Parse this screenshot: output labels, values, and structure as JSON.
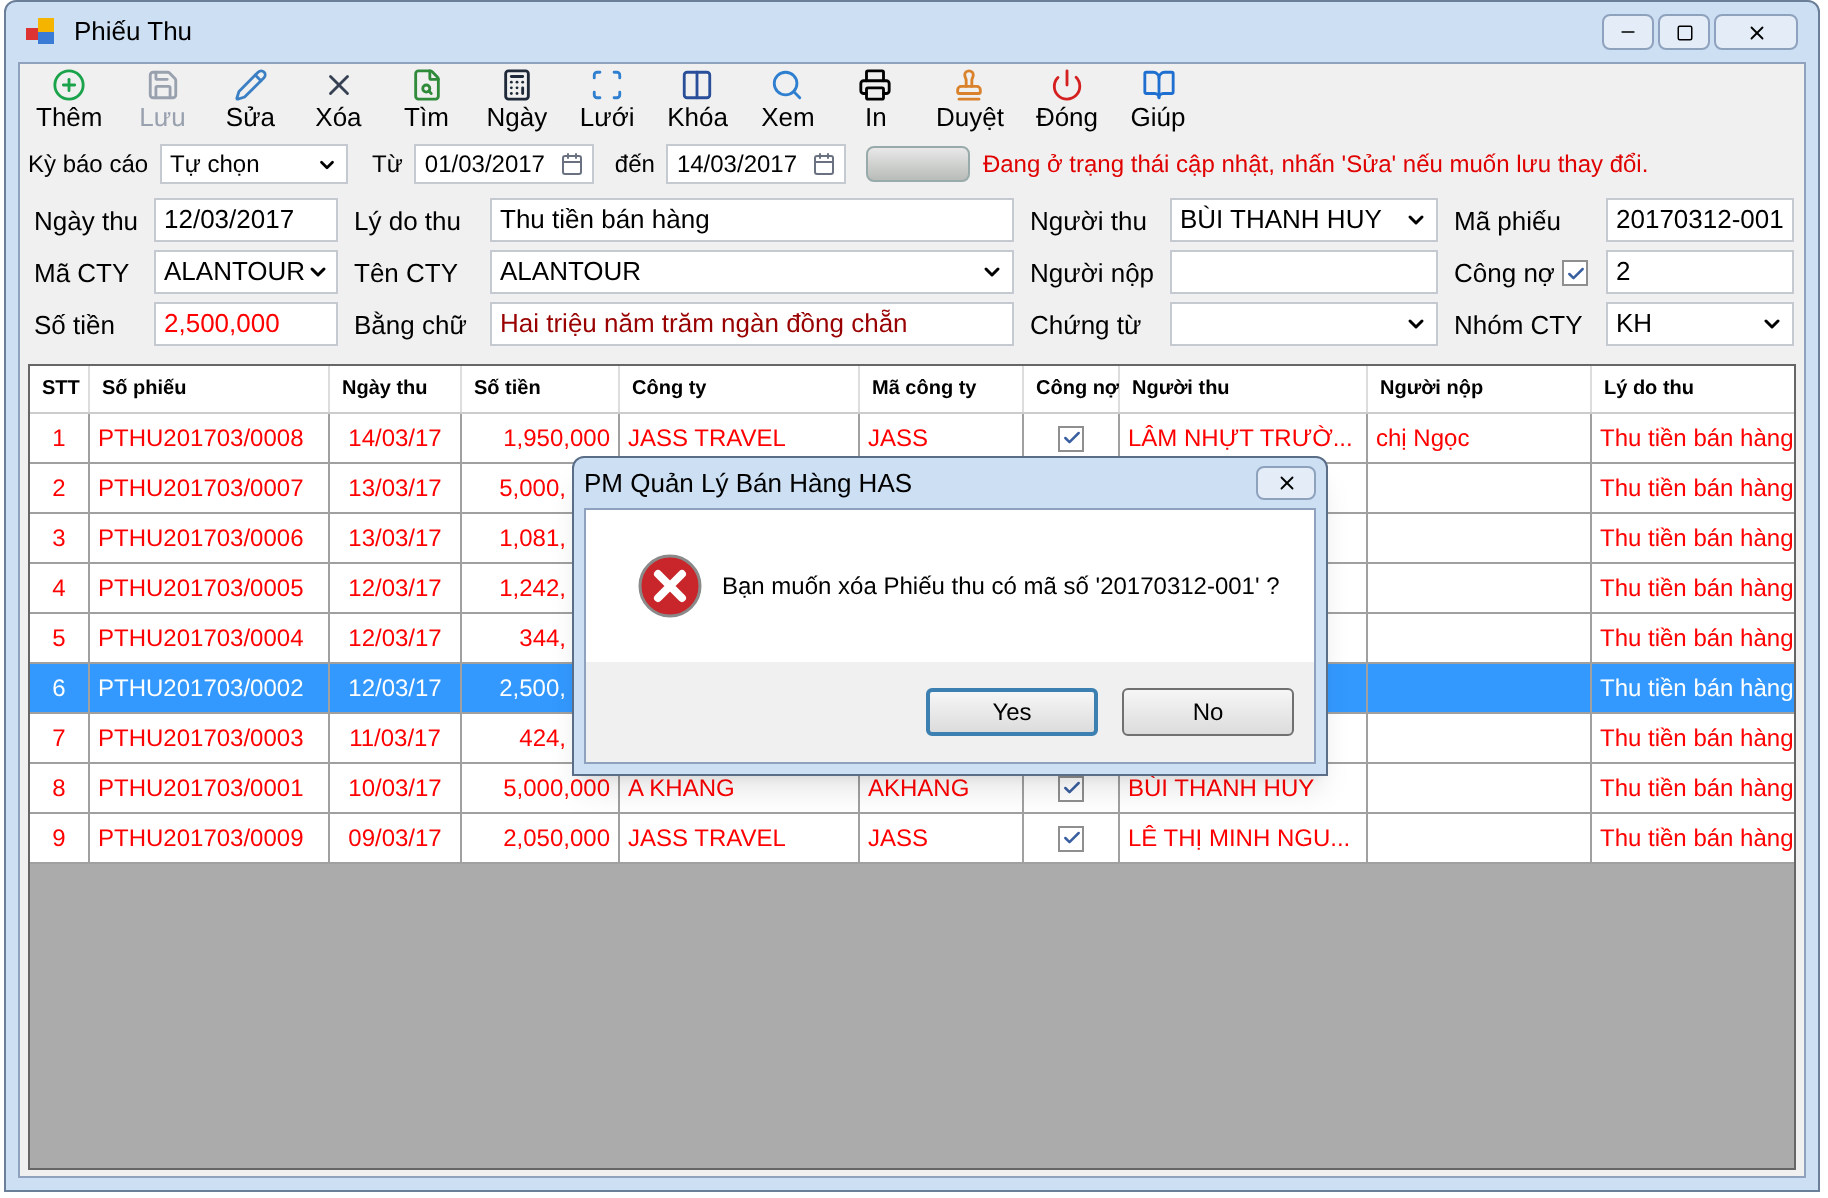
{
  "window": {
    "title": "Phiếu Thu"
  },
  "toolbar": [
    {
      "label": "Thêm",
      "kind": "add",
      "disabled": false
    },
    {
      "label": "Lưu",
      "kind": "save",
      "disabled": true
    },
    {
      "label": "Sửa",
      "kind": "edit",
      "disabled": false
    },
    {
      "label": "Xóa",
      "kind": "delete",
      "disabled": false
    },
    {
      "label": "Tìm",
      "kind": "find",
      "disabled": false
    },
    {
      "label": "Ngày",
      "kind": "date",
      "disabled": false
    },
    {
      "label": "Lưới",
      "kind": "grid",
      "disabled": false
    },
    {
      "label": "Khóa",
      "kind": "lock",
      "disabled": false
    },
    {
      "label": "Xem",
      "kind": "view",
      "disabled": false
    },
    {
      "label": "In",
      "kind": "print",
      "disabled": false
    },
    {
      "label": "Duyệt",
      "kind": "approve",
      "disabled": false
    },
    {
      "label": "Đóng",
      "kind": "close",
      "disabled": false
    },
    {
      "label": "Giúp",
      "kind": "help",
      "disabled": false
    }
  ],
  "filter": {
    "period_label": "Kỳ báo cáo",
    "period": "Tự chọn",
    "from_label": "Từ",
    "from": "01/03/2017",
    "to_label": "đến",
    "to": "14/03/2017",
    "status": "Đang ở trạng thái cập nhật, nhấn 'Sửa' nếu muốn lưu thay đổi."
  },
  "form": [
    [
      {
        "label": "Ngày thu",
        "value": "12/03/2017",
        "kind": "text"
      },
      {
        "label": "Lý do thu",
        "value": "Thu tiền bán hàng",
        "kind": "text"
      },
      {
        "label": "Người thu",
        "value": "BÙI THANH HUY",
        "kind": "combo"
      },
      {
        "label": "Mã phiếu",
        "value": "20170312-001",
        "kind": "text"
      }
    ],
    [
      {
        "label": "Mã CTY",
        "value": "ALANTOUR",
        "kind": "combo"
      },
      {
        "label": "Tên CTY",
        "value": "ALANTOUR",
        "kind": "combo"
      },
      {
        "label": "Người nộp",
        "kind": "text"
      },
      {
        "label": "Công nợ",
        "value": "2",
        "kind": "check",
        "checked": true
      }
    ],
    [
      {
        "label": "Số tiền",
        "value": "2,500,000",
        "kind": "text",
        "color": "#ff0000"
      },
      {
        "label": "Bằng chữ",
        "value": "Hai triệu năm trăm ngàn đồng chẵn",
        "kind": "text",
        "color": "#990000"
      },
      {
        "label": "Chứng từ",
        "kind": "combo"
      },
      {
        "label": "Nhóm CTY",
        "value": "KH",
        "kind": "combo"
      }
    ]
  ],
  "table": {
    "columns": [
      "STT",
      "Số phiếu",
      "Ngày thu",
      "Số tiền",
      "Công ty",
      "Mã công ty",
      "Công nợ",
      "Người thu",
      "Người nộp",
      "Lý do thu"
    ],
    "rows": [
      {
        "stt": "1",
        "number": "PTHU201703/0008",
        "date": "14/03/17",
        "amount": "1,950,000",
        "company": "JASS TRAVEL",
        "code": "JASS",
        "debt": true,
        "collector": "LÂM NHỰT TRƯỜ...",
        "payer": "chị Ngọc",
        "reason": "Thu tiền bán hàng",
        "selected": false
      },
      {
        "stt": "2",
        "number": "PTHU201703/0007",
        "date": "13/03/17",
        "amount": "5,000,",
        "reason": "Thu tiền bán hàng",
        "selected": false
      },
      {
        "stt": "3",
        "number": "PTHU201703/0006",
        "date": "13/03/17",
        "amount": "1,081,",
        "reason": "Thu tiền bán hàng",
        "selected": false
      },
      {
        "stt": "4",
        "number": "PTHU201703/0005",
        "date": "12/03/17",
        "amount": "1,242,",
        "reason": "Thu tiền bán hàng",
        "selected": false
      },
      {
        "stt": "5",
        "number": "PTHU201703/0004",
        "date": "12/03/17",
        "amount": "344,",
        "reason": "Thu tiền bán hàng",
        "selected": false
      },
      {
        "stt": "6",
        "number": "PTHU201703/0002",
        "date": "12/03/17",
        "amount": "2,500,",
        "reason": "Thu tiền bán hàng",
        "selected": true
      },
      {
        "stt": "7",
        "number": "PTHU201703/0003",
        "date": "11/03/17",
        "amount": "424,",
        "reason": "Thu tiền bán hàng",
        "selected": false
      },
      {
        "stt": "8",
        "number": "PTHU201703/0001",
        "date": "10/03/17",
        "amount": "5,000,000",
        "company": "A KHANG",
        "code": "AKHANG",
        "debt": true,
        "collector": "BÙI THANH HUY",
        "reason": "Thu tiền bán hàng",
        "selected": false
      },
      {
        "stt": "9",
        "number": "PTHU201703/0009",
        "date": "09/03/17",
        "amount": "2,050,000",
        "company": "JASS TRAVEL",
        "code": "JASS",
        "debt": true,
        "collector": "LÊ THỊ MINH NGU...",
        "reason": "Thu tiền bán hàng",
        "selected": false
      }
    ]
  },
  "dialog": {
    "title": "PM Quản Lý Bán Hàng HAS",
    "message": "Bạn muốn xóa Phiếu thu có mã số '20170312-001' ?",
    "buttons": [
      {
        "label": "Yes",
        "selected": true
      },
      {
        "label": "No",
        "selected": false
      }
    ]
  }
}
